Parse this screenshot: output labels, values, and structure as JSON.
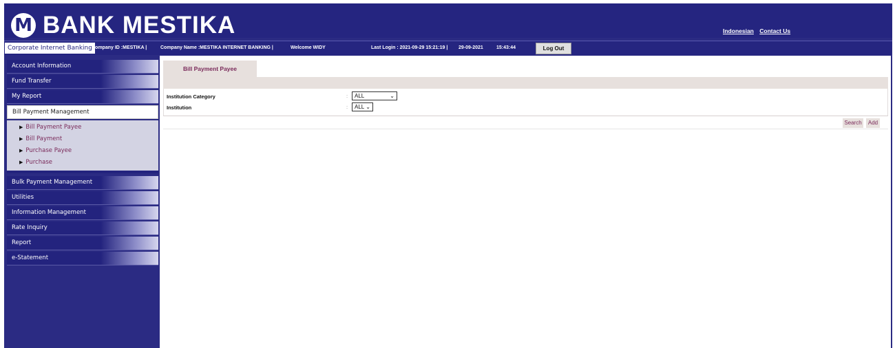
{
  "header": {
    "logo_letter": "M",
    "bank_name": "BANK MESTIKA",
    "links": [
      "Indonesian",
      "Contact Us"
    ]
  },
  "infobar": {
    "app_name": "Corporate Internet Banking",
    "company_id": "Company ID :MESTIKA |",
    "company_name": "Company Name :MESTIKA INTERNET BANKING |",
    "welcome": "Welcome WIDY",
    "last_login": "Last Login : 2021-09-29 15:21:19 |",
    "date": "29-09-2021",
    "time": "15:43:44",
    "logout_label": "Log Out"
  },
  "sidebar": {
    "items_top": [
      "Account Information",
      "Fund Transfer",
      "My Report"
    ],
    "active_item": "Bill Payment Management",
    "sub_items": [
      "Bill Payment Payee",
      "Bill Payment",
      "Purchase Payee",
      "Purchase"
    ],
    "items_bottom": [
      "Bulk Payment Management",
      "Utilities",
      "Information Management",
      "Rate Inquiry",
      "Report",
      "e-Statement"
    ]
  },
  "main": {
    "tab_label": "Bill Payment Payee",
    "fields": [
      {
        "label": "Institution Category",
        "value": "ALL"
      },
      {
        "label": "Institution",
        "value": "ALL"
      }
    ],
    "search_label": "Search",
    "add_label": "Add"
  },
  "colors": {
    "brand_navy": "#252580",
    "tab_bg": "#e7e0dd",
    "link_text": "#7a2a5a"
  }
}
